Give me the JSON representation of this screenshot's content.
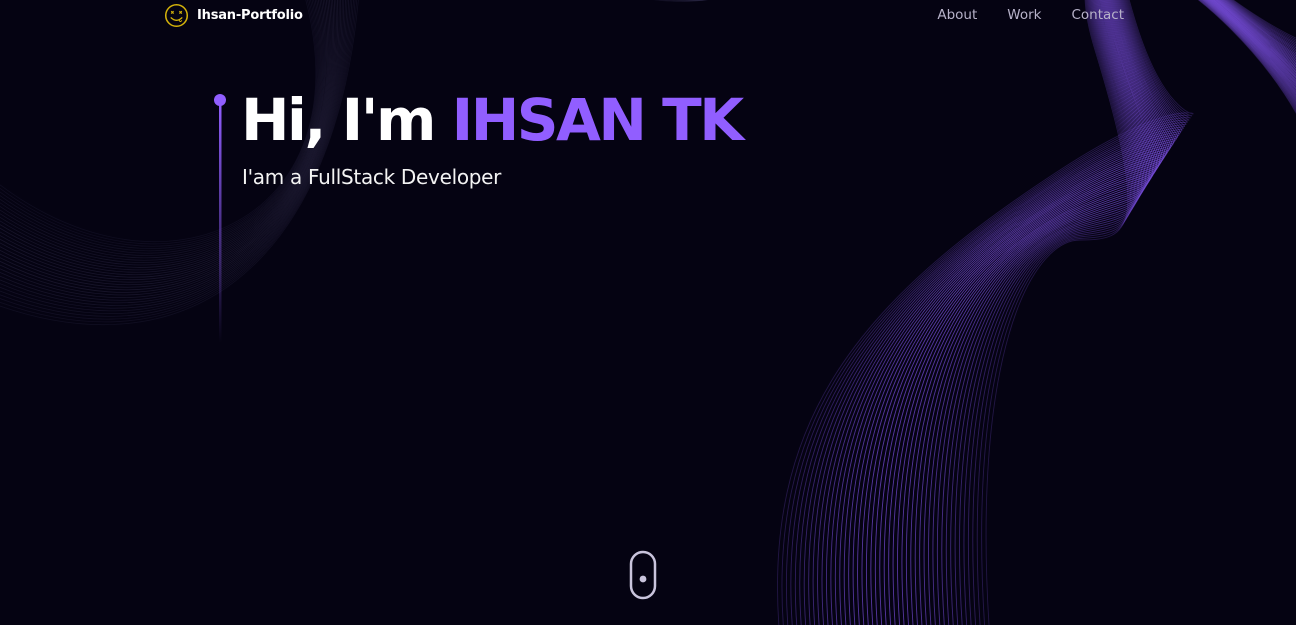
{
  "navbar": {
    "brand": "Ihsan-Portfolio",
    "logo_icon": "smiley-logo-icon",
    "links": [
      "About",
      "Work",
      "Contact"
    ]
  },
  "hero": {
    "greeting": "Hi, I'm ",
    "name": "IHSAN TK",
    "subtitle": "I'am a FullStack Developer"
  },
  "scroll_indicator_icon": "mouse-scroll-icon",
  "colors": {
    "background": "#050312",
    "accent": "#915eff",
    "text": "#ffffff",
    "nav_text": "#b7b2c9",
    "logo": "#d4b20a"
  }
}
